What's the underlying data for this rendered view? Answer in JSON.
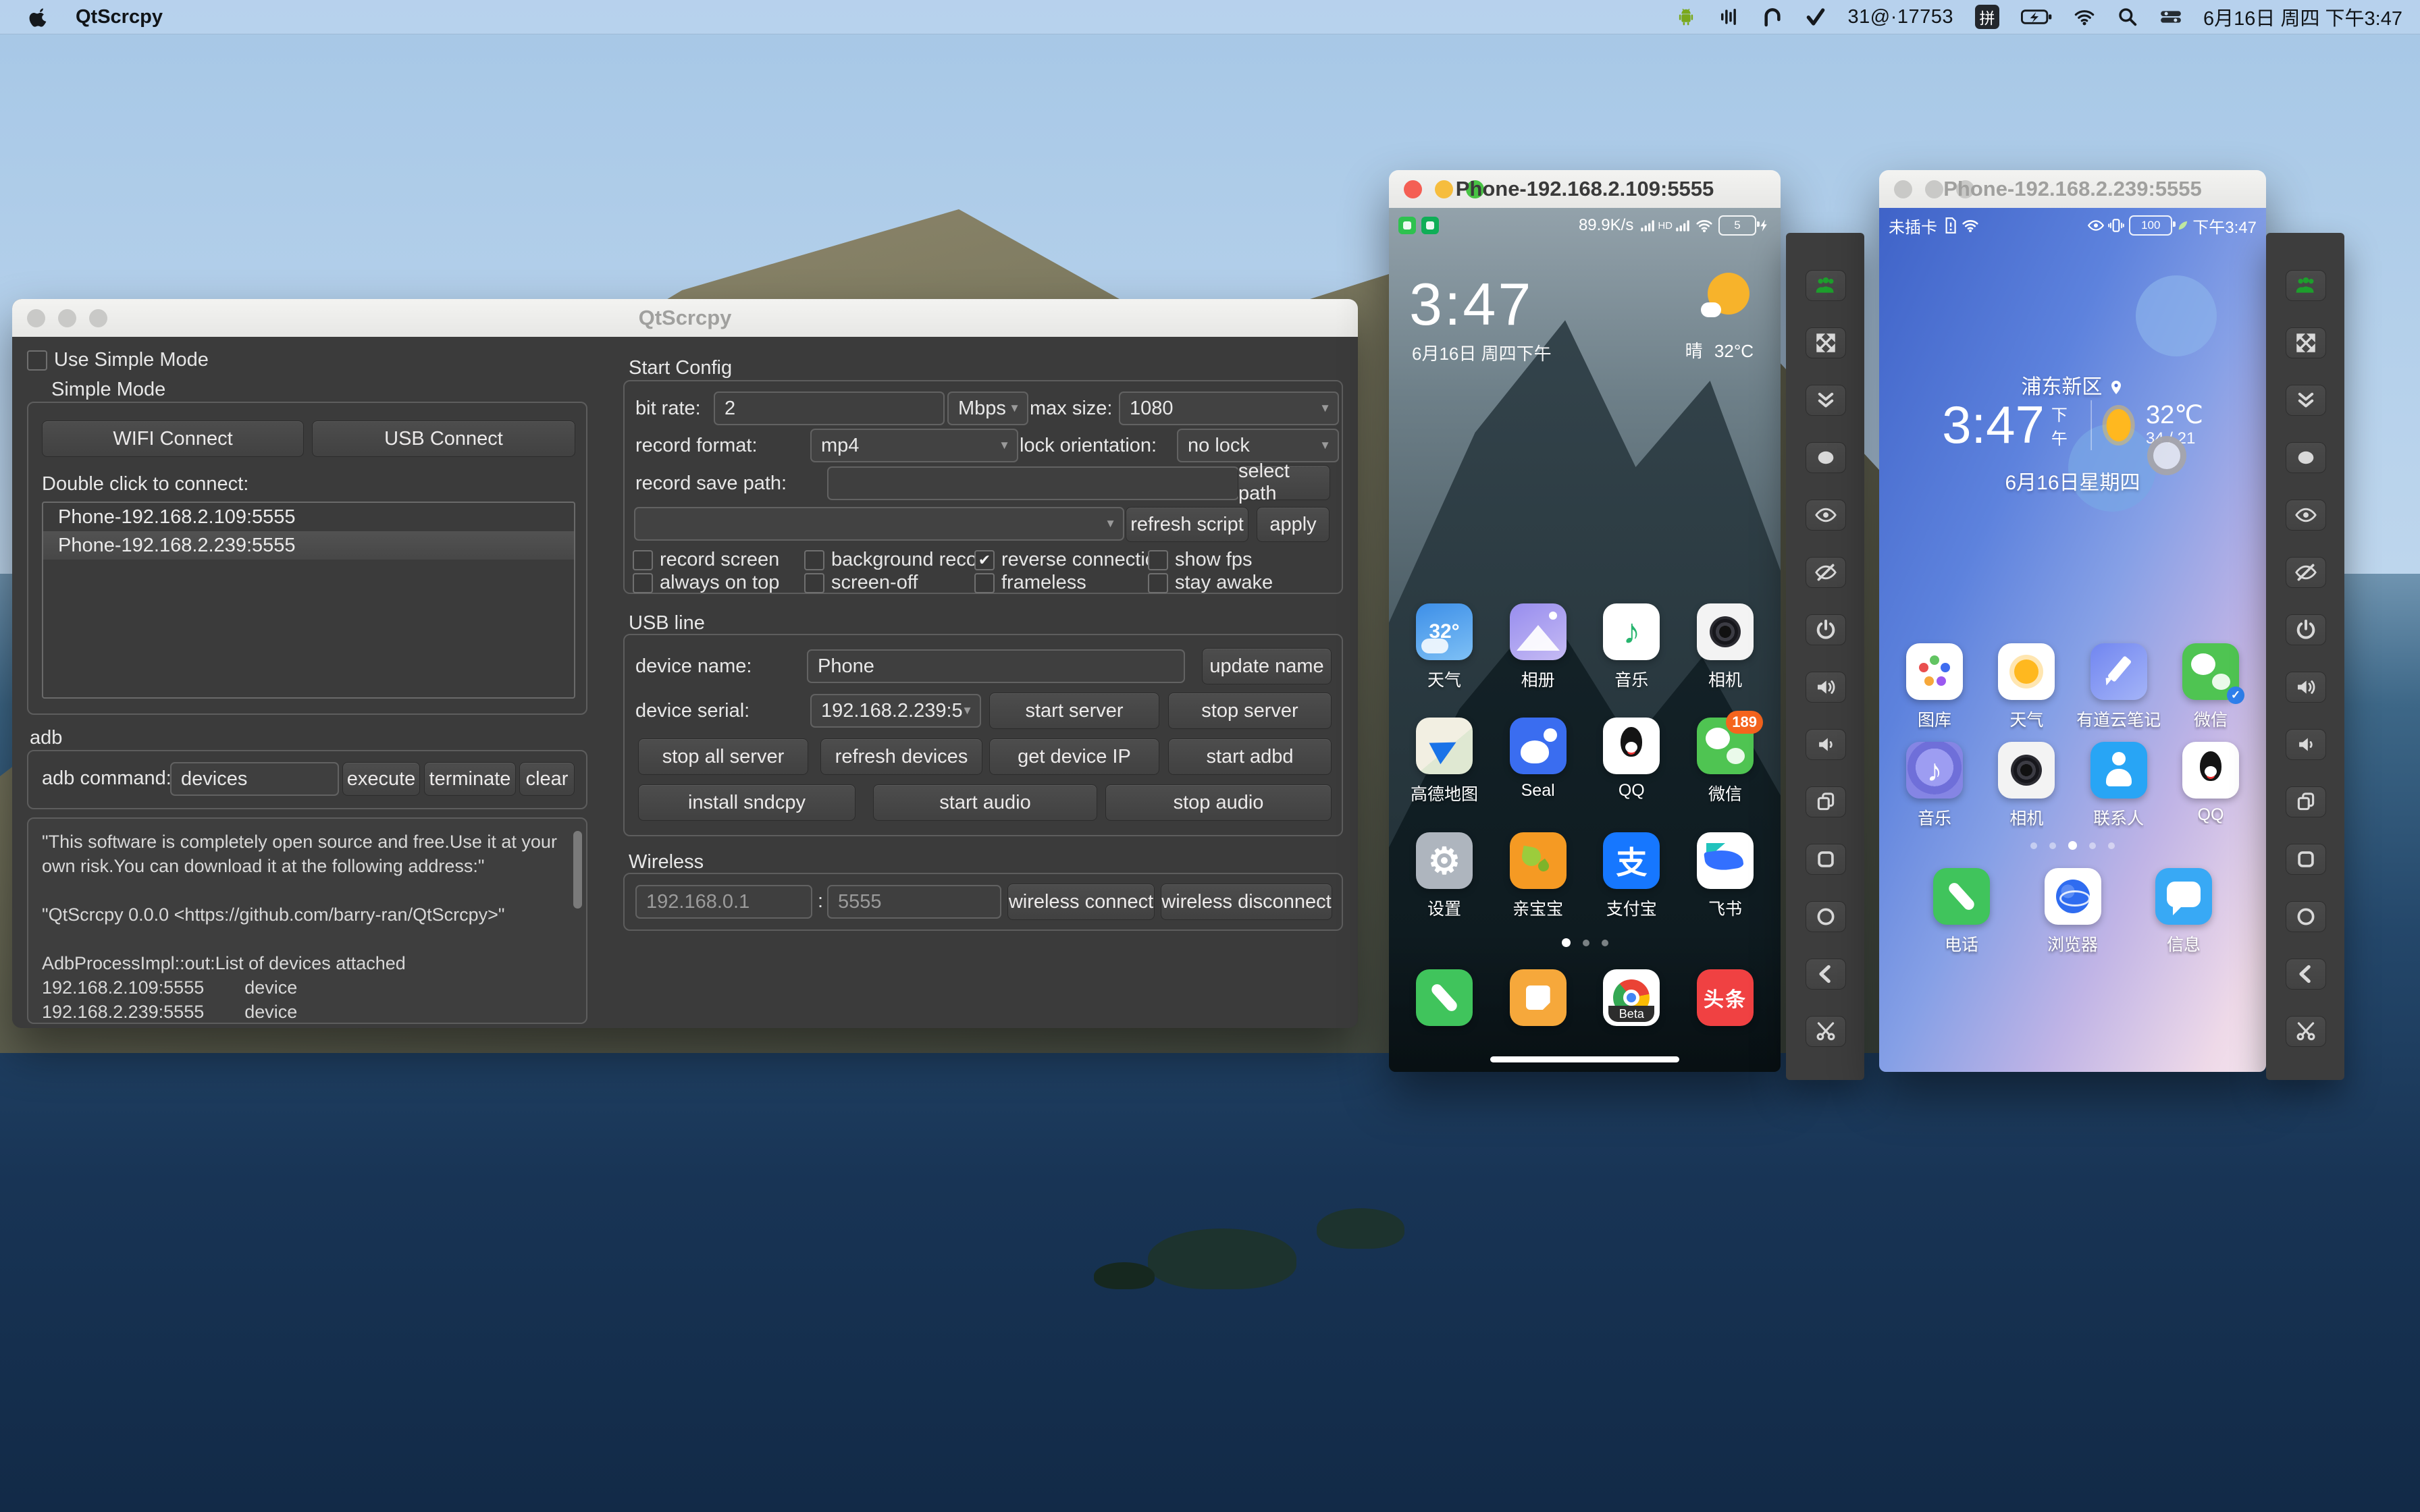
{
  "menu_bar": {
    "app_name": "QtScrcpy",
    "status_count": "31@·17753",
    "input_method_label": "拼",
    "datetime": "6月16日 周四 下午3:47"
  },
  "mw": {
    "title": "QtScrcpy",
    "use_simple_mode": "Use Simple Mode",
    "simple_mode": "Simple Mode",
    "wifi_connect": "WIFI Connect",
    "usb_connect": "USB Connect",
    "double_click_hint": "Double click to connect:",
    "devices": [
      {
        "label": "Phone-192.168.2.109:5555",
        "selected": false
      },
      {
        "label": "Phone-192.168.2.239:5555",
        "selected": true
      }
    ],
    "adb_section": "adb",
    "adb_command_label": "adb command:",
    "adb_command_value": "devices",
    "btn_execute": "execute",
    "btn_terminate": "terminate",
    "btn_clear": "clear",
    "log_lines": [
      "\"This software is completely open source and free.Use it at your own risk.You can download it at the following address:\"",
      "",
      "\"QtScrcpy 0.0.0 <https://github.com/barry-ran/QtScrcpy>\"",
      "",
      "AdbProcessImpl::out:List of devices attached",
      "192.168.2.109:5555        device",
      "192.168.2.239:5555        device"
    ],
    "sc": {
      "title": "Start Config",
      "bit_rate_label": "bit rate:",
      "bit_rate_value": "2",
      "bit_rate_unit": "Mbps",
      "max_size_label": "max size:",
      "max_size_value": "1080",
      "record_format_label": "record format:",
      "record_format_value": "mp4",
      "lock_orientation_label": "lock orientation:",
      "lock_orientation_value": "no lock",
      "record_save_path_label": "record save path:",
      "record_save_path_value": "",
      "btn_select_path": "select path",
      "script_value": "",
      "btn_refresh_script": "refresh script",
      "btn_apply": "apply",
      "cb": [
        {
          "label": "record screen",
          "checked": false
        },
        {
          "label": "background record",
          "checked": false
        },
        {
          "label": "reverse connection",
          "checked": true
        },
        {
          "label": "show fps",
          "checked": false
        },
        {
          "label": "always on top",
          "checked": false
        },
        {
          "label": "screen-off",
          "checked": false
        },
        {
          "label": "frameless",
          "checked": false
        },
        {
          "label": "stay awake",
          "checked": false
        }
      ]
    },
    "usb": {
      "title": "USB line",
      "device_name_label": "device name:",
      "device_name_value": "Phone",
      "btn_update_name": "update name",
      "device_serial_label": "device serial:",
      "device_serial_value": "192.168.2.239:5",
      "btn_start_server": "start server",
      "btn_stop_server": "stop server",
      "btn_stop_all_server": "stop all server",
      "btn_refresh_devices": "refresh devices",
      "btn_get_device_ip": "get device IP",
      "btn_start_adbd": "start adbd",
      "btn_install_sndcpy": "install sndcpy",
      "btn_start_audio": "start audio",
      "btn_stop_audio": "stop audio"
    },
    "wl": {
      "title": "Wireless",
      "ip": "192.168.0.1",
      "colon": ":",
      "port": "5555",
      "btn_connect": "wireless connect",
      "btn_disconnect": "wireless disconnect"
    }
  },
  "p1": {
    "title": "Phone-192.168.2.109:5555",
    "status": {
      "net_speed": "89.9K/s",
      "hd": "HD",
      "battery": "5"
    },
    "clock": "3:47",
    "date": "6月16日 周四下午",
    "weather": {
      "cond": "晴",
      "temp": "32°C"
    },
    "apps": [
      {
        "label": "天气",
        "glyph": "32°"
      },
      {
        "label": "相册"
      },
      {
        "label": "音乐",
        "glyph": "♪"
      },
      {
        "label": "相机"
      },
      {
        "label": "高德地图",
        "glyph": "▶"
      },
      {
        "label": "Seal"
      },
      {
        "label": "QQ"
      },
      {
        "label": "微信",
        "badge": "189"
      },
      {
        "label": "设置",
        "glyph": "⚙"
      },
      {
        "label": "亲宝宝"
      },
      {
        "label": "支付宝",
        "glyph": "支"
      },
      {
        "label": "飞书"
      }
    ],
    "dock": {
      "beta": "Beta",
      "toutiao": "头条"
    },
    "dots": {
      "count": 3,
      "active": 0
    }
  },
  "p2": {
    "title": "Phone-192.168.2.239:5555",
    "status": {
      "left": "未插卡",
      "battery": "100",
      "time": "下午3:47"
    },
    "location": "浦东新区",
    "clock": "3:47",
    "ampm": "下午",
    "temp": "32℃",
    "temp_range": "34 / 21",
    "date": "6月16日星期四",
    "apps": [
      {
        "label": "图库"
      },
      {
        "label": "天气"
      },
      {
        "label": "有道云笔记"
      },
      {
        "label": "微信"
      },
      {
        "label": "音乐",
        "glyph": "♪"
      },
      {
        "label": "相机"
      },
      {
        "label": "联系人"
      },
      {
        "label": "QQ"
      }
    ],
    "dock": [
      {
        "label": "电话"
      },
      {
        "label": "浏览器"
      },
      {
        "label": "信息"
      }
    ],
    "dots": {
      "count": 5,
      "active": 2
    }
  },
  "toolbar_buttons": [
    "group-control",
    "full-screen",
    "expand-notification",
    "touch",
    "screen-on",
    "screen-off",
    "power",
    "volume-up",
    "volume-down",
    "app-switch",
    "menu",
    "home",
    "back",
    "screenshot"
  ],
  "colors": {
    "window_bg": "#3b3b3b",
    "selection_row": "#4f4f4f",
    "titlebar_active_text": "#3a3a3a",
    "titlebar_inactive_text": "#a0a09e",
    "wechat_badge": "#f5641d",
    "toolbar_accent_green": "#1d9e2c",
    "traffic_red": "#f45f54",
    "traffic_yellow": "#f6bd3e",
    "traffic_green": "#48c344"
  }
}
